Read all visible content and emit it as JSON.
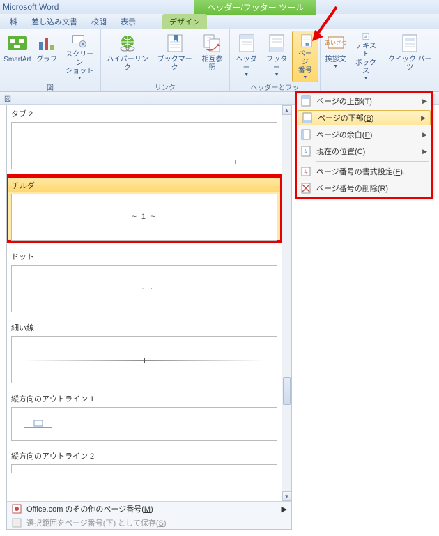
{
  "app": {
    "title": "Microsoft Word",
    "tool_tab": "ヘッダー/フッター ツール"
  },
  "tabs": {
    "items": [
      "料",
      "差し込み文書",
      "校閲",
      "表示",
      "デザイン"
    ],
    "active_index": 4
  },
  "ribbon": {
    "group1_label": "図",
    "group2_label": "リンク",
    "group3_label": "ヘッダーとフッ",
    "btn_smartart": "SmartArt",
    "btn_chart": "グラフ",
    "btn_screenshot": "スクリーン\nショット",
    "btn_hyperlink": "ハイパーリンク",
    "btn_bookmark": "ブックマーク",
    "btn_crossref": "相互参照",
    "btn_header": "ヘッダー",
    "btn_footer": "フッター",
    "btn_pagenum": "ページ\n番号",
    "btn_aisatsu": "挨拶文",
    "btn_textbox": "テキスト\nボックス",
    "btn_quickparts": "クイック パーツ"
  },
  "menu": {
    "top": "ページの上部(T)",
    "bottom": "ページの下部(B)",
    "margin": "ページの余白(P)",
    "current": "現在の位置(C)",
    "format": "ページ番号の書式設定(F)...",
    "remove": "ページ番号の削除(R)"
  },
  "gallery": {
    "item_tab2": "タブ 2",
    "item_tilde": "チルダ",
    "item_tilde_sample": "~ 1 ~",
    "item_dot": "ドット",
    "item_dot_sample": ". . .",
    "item_thinline": "細い線",
    "item_voutline1": "縦方向のアウトライン 1",
    "item_voutline2": "縦方向のアウトライン 2",
    "footer_office": "Office.com のその他のページ番号(M)",
    "footer_save": "選択範囲をページ番号(下) として保存(S)"
  },
  "topstrip": {
    "label": "図"
  }
}
